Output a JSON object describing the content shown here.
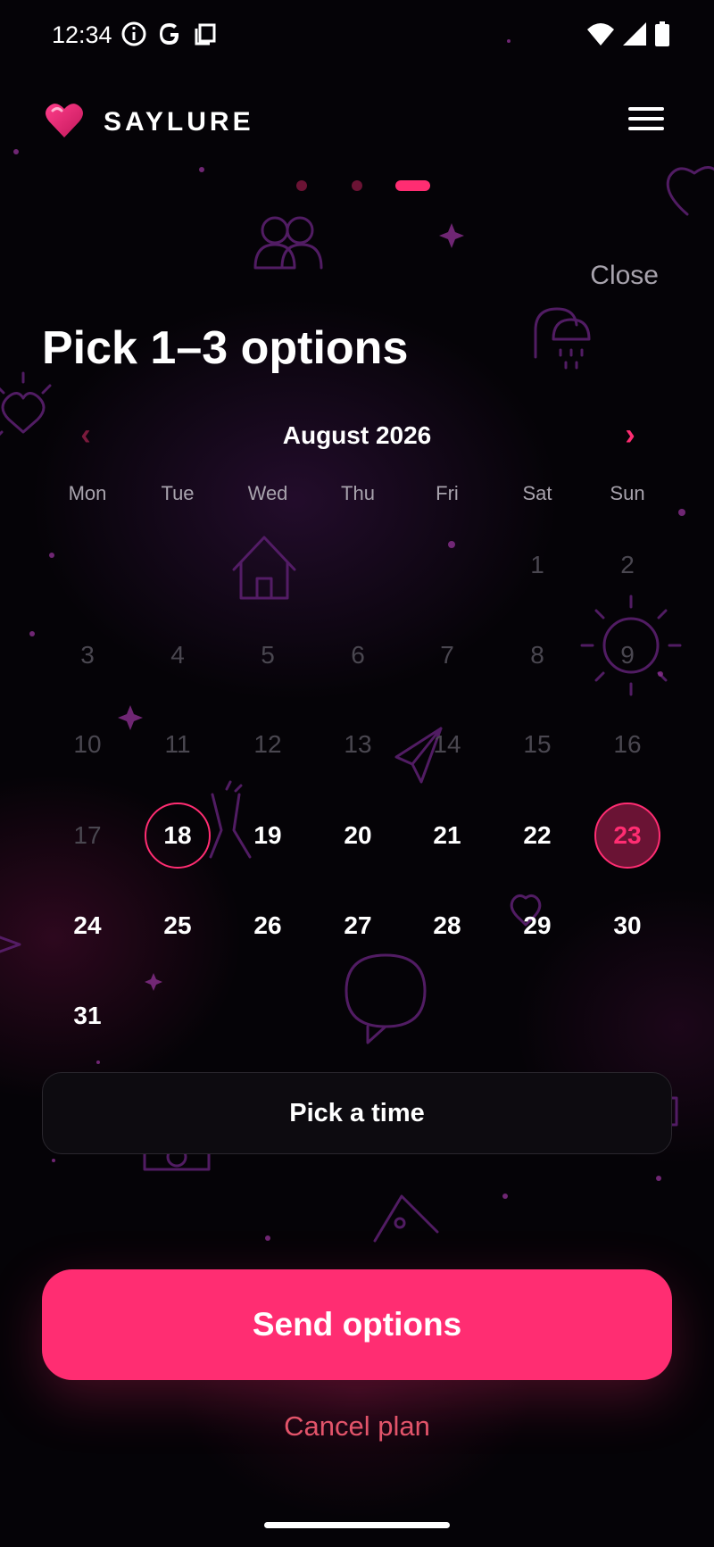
{
  "status_bar": {
    "time": "12:34",
    "left_icons": [
      "info-icon",
      "google-icon",
      "copy-icon"
    ],
    "right_icons": [
      "wifi-icon",
      "signal-icon",
      "battery-icon"
    ]
  },
  "header": {
    "brand": "SAYLURE",
    "logo_icon": "heart-icon",
    "menu_icon": "hamburger-menu-icon"
  },
  "steps": {
    "total": 3,
    "active": 3
  },
  "close_label": "Close",
  "title": "Pick 1–3 options",
  "calendar": {
    "month_label": "August 2026",
    "prev_icon": "chevron-left-icon",
    "next_icon": "chevron-right-icon",
    "prev_glyph": "‹",
    "next_glyph": "›",
    "weekdays": [
      "Mon",
      "Tue",
      "Wed",
      "Thu",
      "Fri",
      "Sat",
      "Sun"
    ],
    "rows": [
      [
        null,
        null,
        null,
        null,
        null,
        "1",
        "2"
      ],
      [
        "3",
        "4",
        "5",
        "6",
        "7",
        "8",
        "9"
      ],
      [
        "10",
        "11",
        "12",
        "13",
        "14",
        "15",
        "16"
      ],
      [
        "17",
        "18",
        "19",
        "20",
        "21",
        "22",
        "23"
      ],
      [
        "24",
        "25",
        "26",
        "27",
        "28",
        "29",
        "30"
      ],
      [
        "31",
        null,
        null,
        null,
        null,
        null,
        null
      ]
    ],
    "past_days": [
      "1",
      "2",
      "3",
      "4",
      "5",
      "6",
      "7",
      "8",
      "9",
      "10",
      "11",
      "12",
      "13",
      "14",
      "15",
      "16",
      "17"
    ],
    "selected_ring_day": "18",
    "selected_fill_day": "23"
  },
  "pick_time_label": "Pick a time",
  "send_button_label": "Send options",
  "cancel_label": "Cancel plan",
  "colors": {
    "accent": "#ff2d72",
    "background": "#050307",
    "cancel": "#e2546a",
    "muted": "#a8a3ad",
    "past_day": "#4a4750"
  }
}
